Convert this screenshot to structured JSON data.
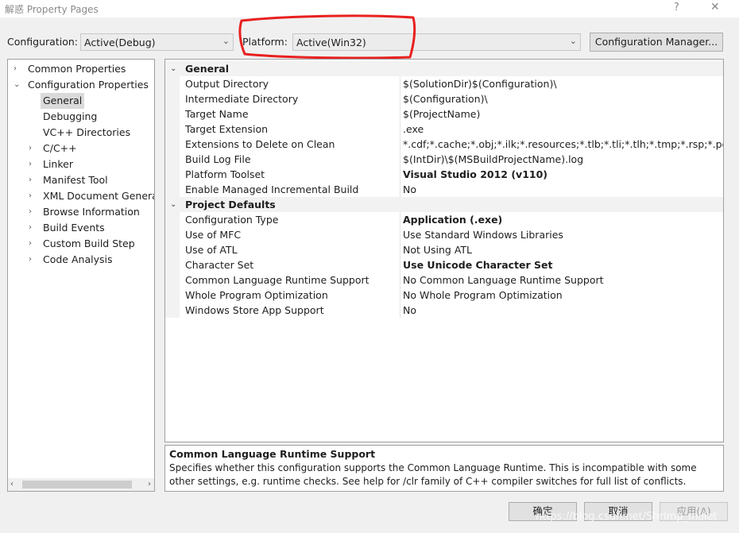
{
  "window": {
    "title": "解惑 Property Pages",
    "help": "?",
    "close": "✕"
  },
  "toolbar": {
    "configuration_label": "Configuration:",
    "configuration_value": "Active(Debug)",
    "platform_label": "Platform:",
    "platform_value": "Active(Win32)",
    "config_manager_label": "Configuration Manager..."
  },
  "tree": {
    "items": [
      {
        "label": "Common Properties",
        "expander": "›"
      },
      {
        "label": "Configuration Properties",
        "expander": "⌄"
      },
      {
        "label": "General"
      },
      {
        "label": "Debugging"
      },
      {
        "label": "VC++ Directories"
      },
      {
        "label": "C/C++",
        "expander": "›"
      },
      {
        "label": "Linker",
        "expander": "›"
      },
      {
        "label": "Manifest Tool",
        "expander": "›"
      },
      {
        "label": "XML Document Generat",
        "expander": "›"
      },
      {
        "label": "Browse Information",
        "expander": "›"
      },
      {
        "label": "Build Events",
        "expander": "›"
      },
      {
        "label": "Custom Build Step",
        "expander": "›"
      },
      {
        "label": "Code Analysis",
        "expander": "›"
      }
    ],
    "scroll_left": "‹",
    "scroll_right": "›"
  },
  "grid": {
    "general": {
      "title": "General",
      "rows": [
        {
          "name": "Output Directory",
          "value": "$(SolutionDir)$(Configuration)\\"
        },
        {
          "name": "Intermediate Directory",
          "value": "$(Configuration)\\"
        },
        {
          "name": "Target Name",
          "value": "$(ProjectName)"
        },
        {
          "name": "Target Extension",
          "value": ".exe"
        },
        {
          "name": "Extensions to Delete on Clean",
          "value": "*.cdf;*.cache;*.obj;*.ilk;*.resources;*.tlb;*.tli;*.tlh;*.tmp;*.rsp;*.pgc;*.pgd;*"
        },
        {
          "name": "Build Log File",
          "value": "$(IntDir)\\$(MSBuildProjectName).log"
        },
        {
          "name": "Platform Toolset",
          "value": "Visual Studio 2012 (v110)"
        },
        {
          "name": "Enable Managed Incremental Build",
          "value": "No"
        }
      ]
    },
    "project_defaults": {
      "title": "Project Defaults",
      "rows": [
        {
          "name": "Configuration Type",
          "value": "Application (.exe)"
        },
        {
          "name": "Use of MFC",
          "value": "Use Standard Windows Libraries"
        },
        {
          "name": "Use of ATL",
          "value": "Not Using ATL"
        },
        {
          "name": "Character Set",
          "value": "Use Unicode Character Set"
        },
        {
          "name": "Common Language Runtime Support",
          "value": "No Common Language Runtime Support"
        },
        {
          "name": "Whole Program Optimization",
          "value": "No Whole Program Optimization"
        },
        {
          "name": "Windows Store App Support",
          "value": "No"
        }
      ]
    }
  },
  "description": {
    "title": "Common Language Runtime Support",
    "text": "Specifies whether this configuration supports the Common Language Runtime. This is incompatible with some other settings, e.g. runtime checks. See help for /clr family of C++ compiler switches for full list of conflicts."
  },
  "footer": {
    "ok": "确定",
    "cancel": "取消",
    "apply": "应用(A)"
  },
  "watermark": "https://blog.csdn.net/Shrimp_millet",
  "colors": {
    "annotation": "#e8201f",
    "selection": "#dadada"
  }
}
